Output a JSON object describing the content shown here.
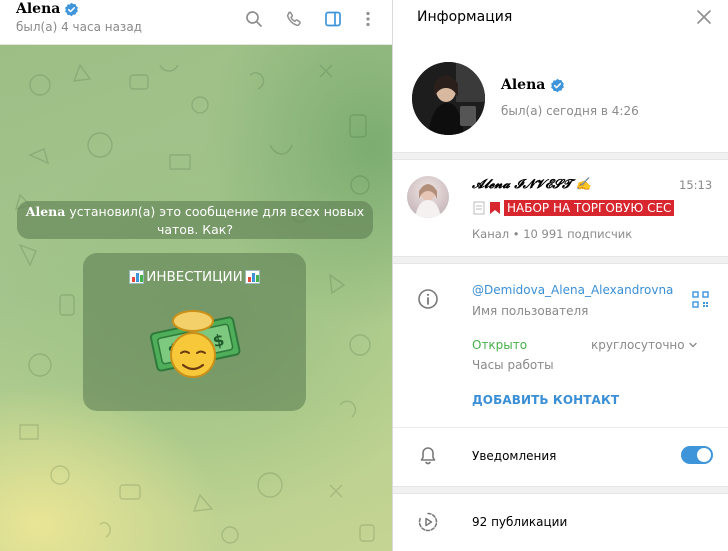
{
  "chat": {
    "name": "Alena",
    "status": "был(а) 4 часа назад",
    "service_message_name": "Alena",
    "service_message_text": " установил(а) это сообщение для всех новых чатов. Как?",
    "intro_title": "ИНВЕСТИЦИИ",
    "icons": [
      "search-icon",
      "phone-icon",
      "side-panel-icon",
      "more-vert-icon",
      "verified-icon",
      "chart-emoji",
      "money-sticker"
    ]
  },
  "info": {
    "header_title": "Информация",
    "profile_name": "Alena",
    "profile_status": "был(а) сегодня в 4:26",
    "channel": {
      "name": "𝓐𝓵𝓮𝓷𝓪 𝓘𝓝𝓥𝓔𝓢𝓣 ✍",
      "time": "15:13",
      "preview": "НАБОР НА ТОРГОВУЮ СЕС",
      "subscribers": "Канал • 10 991 подписчик"
    },
    "username": "@Demidova_Alena_Alexandrovna",
    "username_caption": "Имя пользователя",
    "hours_status": "Открыто",
    "hours_value": "круглосуточно",
    "hours_caption": "Часы работы",
    "add_contact": "ДОБАВИТЬ КОНТАКТ",
    "notifications_label": "Уведомления",
    "notifications_on": true,
    "posts_label": "92 публикации",
    "icons": [
      "close-icon",
      "info-icon",
      "qr-code-icon",
      "chevron-down-icon",
      "bell-icon",
      "stories-icon"
    ]
  },
  "colors": {
    "accent": "#3e95da",
    "link": "#3a8fd6",
    "online_green": "#46b04a",
    "badge_red": "#d7262e",
    "chat_bg": "#a4c58c"
  }
}
